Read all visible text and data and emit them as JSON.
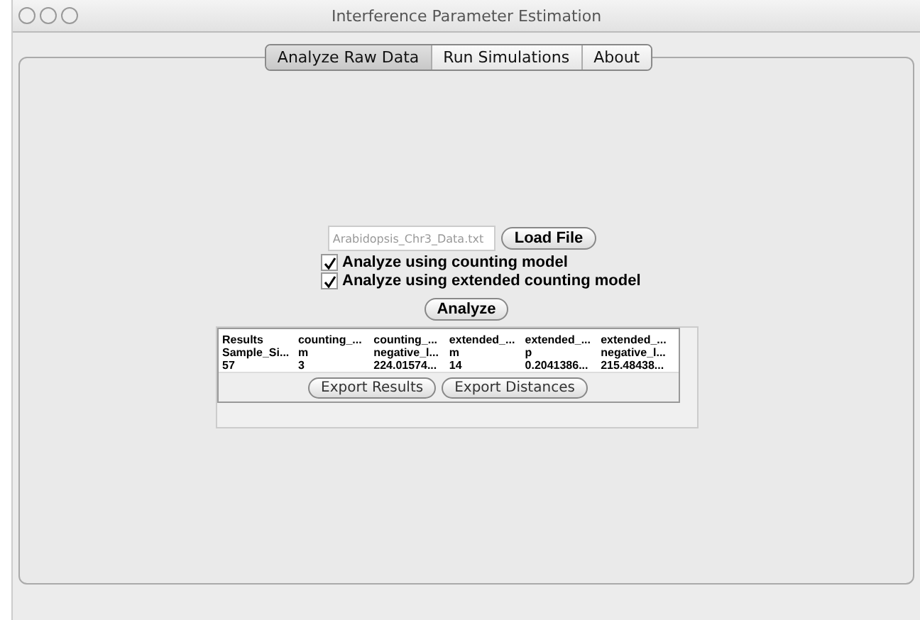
{
  "window": {
    "title": "Interference Parameter Estimation"
  },
  "tabs": [
    {
      "label": "Analyze Raw Data",
      "selected": true
    },
    {
      "label": "Run Simulations",
      "selected": false
    },
    {
      "label": "About",
      "selected": false
    }
  ],
  "file_field": {
    "value": "Arabidopsis_Chr3_Data.txt"
  },
  "load_button": "Load File",
  "options": [
    {
      "label": "Analyze using counting model",
      "checked": true
    },
    {
      "label": "Analyze using extended counting model",
      "checked": true
    }
  ],
  "analyze_button": "Analyze",
  "table": {
    "rows": [
      [
        "Results",
        "counting_...",
        "counting_...",
        "extended_...",
        "extended_...",
        "extended_..."
      ],
      [
        "Sample_Si...",
        "m",
        "negative_l...",
        "m",
        "p",
        "negative_l..."
      ],
      [
        "57",
        "3",
        "224.01574...",
        "14",
        "0.2041386...",
        "215.48438..."
      ]
    ]
  },
  "export_buttons": [
    "Export Results",
    "Export Distances"
  ]
}
